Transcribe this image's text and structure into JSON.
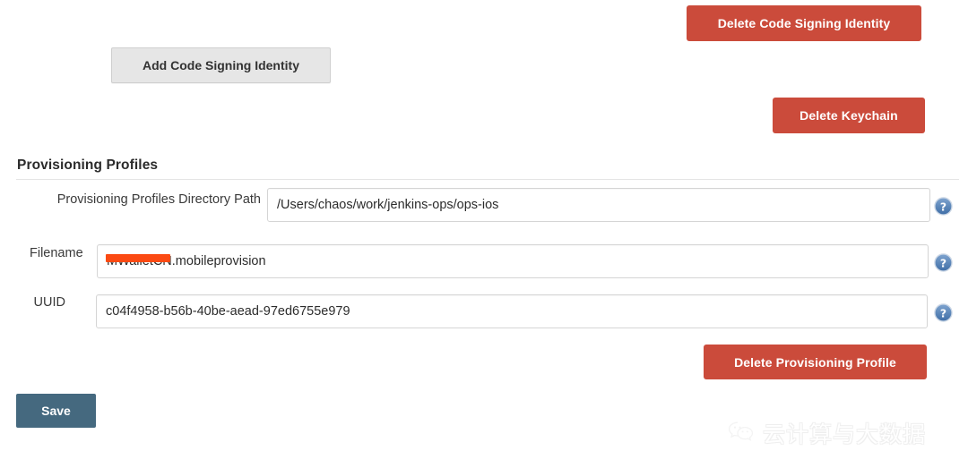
{
  "colors": {
    "danger": "#cb4b3b",
    "save": "#45697f",
    "default_button": "#e6e6e6",
    "help_icon": "#4a7ab5",
    "redaction": "#fb4a13",
    "rule": "#e4e4e4"
  },
  "buttons": {
    "delete_code_signing_identity": "Delete Code Signing Identity",
    "add_code_signing_identity": "Add Code Signing Identity",
    "delete_keychain": "Delete Keychain",
    "delete_provisioning_profile": "Delete Provisioning Profile",
    "save": "Save"
  },
  "section": {
    "title": "Provisioning Profiles"
  },
  "fields": [
    {
      "label": "Provisioning Profiles Directory Path",
      "value": "/Users/chaos/work/jenkins-ops/ops-ios",
      "placeholder": "",
      "help": "help-icon"
    },
    {
      "label": "Filename",
      "value": "MWalletCN.mobileprovision",
      "placeholder": "",
      "help": "help-icon",
      "redacted": true
    },
    {
      "label": "UUID",
      "value": "c04f4958-b56b-40be-aead-97ed6755e979",
      "placeholder": "",
      "help": "help-icon"
    }
  ],
  "watermark": {
    "icon": "wechat-icon",
    "text": "云计算与大数据"
  }
}
